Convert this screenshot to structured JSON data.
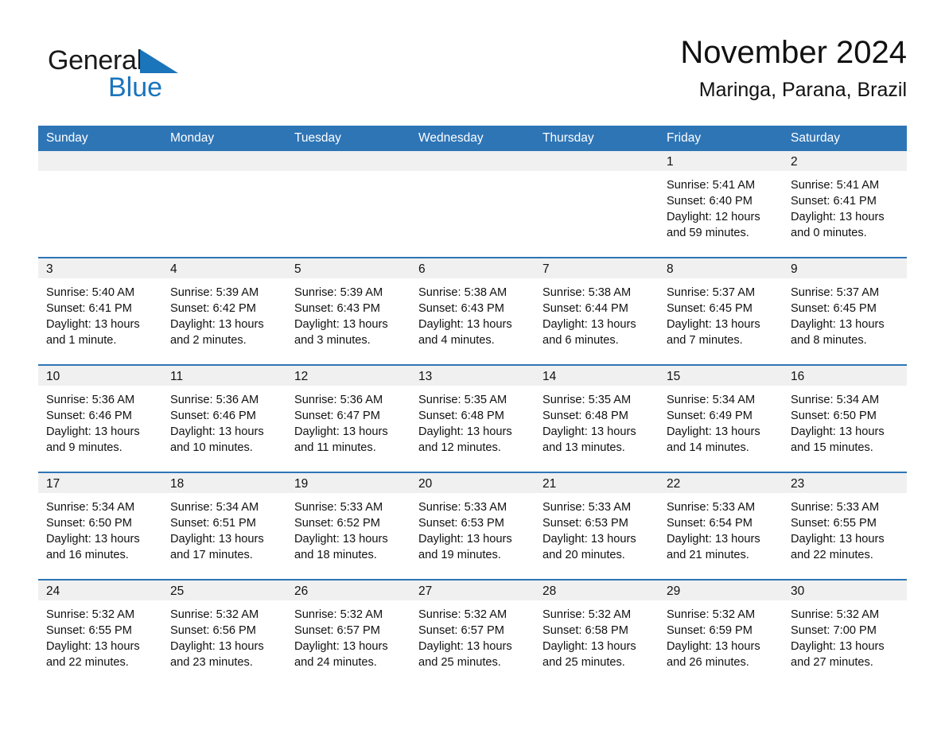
{
  "brand": {
    "word1": "General",
    "word2": "Blue",
    "triangle_color": "#1a75bb",
    "text_color": "#1a1a1a"
  },
  "header": {
    "title": "November 2024",
    "subtitle": "Maringa, Parana, Brazil"
  },
  "theme": {
    "header_blue": "#2e75b6",
    "row_divider_blue": "#2e75b6",
    "daynum_band_gray": "#f0f0f0",
    "page_background": "#ffffff"
  },
  "calendar": {
    "weekday_headers": [
      "Sunday",
      "Monday",
      "Tuesday",
      "Wednesday",
      "Thursday",
      "Friday",
      "Saturday"
    ],
    "weeks": [
      [
        {
          "day": "",
          "empty": true,
          "sunrise": "",
          "sunset": "",
          "daylight1": "",
          "daylight2": ""
        },
        {
          "day": "",
          "empty": true,
          "sunrise": "",
          "sunset": "",
          "daylight1": "",
          "daylight2": ""
        },
        {
          "day": "",
          "empty": true,
          "sunrise": "",
          "sunset": "",
          "daylight1": "",
          "daylight2": ""
        },
        {
          "day": "",
          "empty": true,
          "sunrise": "",
          "sunset": "",
          "daylight1": "",
          "daylight2": ""
        },
        {
          "day": "",
          "empty": true,
          "sunrise": "",
          "sunset": "",
          "daylight1": "",
          "daylight2": ""
        },
        {
          "day": "1",
          "empty": false,
          "sunrise": "Sunrise: 5:41 AM",
          "sunset": "Sunset: 6:40 PM",
          "daylight1": "Daylight: 12 hours",
          "daylight2": "and 59 minutes."
        },
        {
          "day": "2",
          "empty": false,
          "sunrise": "Sunrise: 5:41 AM",
          "sunset": "Sunset: 6:41 PM",
          "daylight1": "Daylight: 13 hours",
          "daylight2": "and 0 minutes."
        }
      ],
      [
        {
          "day": "3",
          "empty": false,
          "sunrise": "Sunrise: 5:40 AM",
          "sunset": "Sunset: 6:41 PM",
          "daylight1": "Daylight: 13 hours",
          "daylight2": "and 1 minute."
        },
        {
          "day": "4",
          "empty": false,
          "sunrise": "Sunrise: 5:39 AM",
          "sunset": "Sunset: 6:42 PM",
          "daylight1": "Daylight: 13 hours",
          "daylight2": "and 2 minutes."
        },
        {
          "day": "5",
          "empty": false,
          "sunrise": "Sunrise: 5:39 AM",
          "sunset": "Sunset: 6:43 PM",
          "daylight1": "Daylight: 13 hours",
          "daylight2": "and 3 minutes."
        },
        {
          "day": "6",
          "empty": false,
          "sunrise": "Sunrise: 5:38 AM",
          "sunset": "Sunset: 6:43 PM",
          "daylight1": "Daylight: 13 hours",
          "daylight2": "and 4 minutes."
        },
        {
          "day": "7",
          "empty": false,
          "sunrise": "Sunrise: 5:38 AM",
          "sunset": "Sunset: 6:44 PM",
          "daylight1": "Daylight: 13 hours",
          "daylight2": "and 6 minutes."
        },
        {
          "day": "8",
          "empty": false,
          "sunrise": "Sunrise: 5:37 AM",
          "sunset": "Sunset: 6:45 PM",
          "daylight1": "Daylight: 13 hours",
          "daylight2": "and 7 minutes."
        },
        {
          "day": "9",
          "empty": false,
          "sunrise": "Sunrise: 5:37 AM",
          "sunset": "Sunset: 6:45 PM",
          "daylight1": "Daylight: 13 hours",
          "daylight2": "and 8 minutes."
        }
      ],
      [
        {
          "day": "10",
          "empty": false,
          "sunrise": "Sunrise: 5:36 AM",
          "sunset": "Sunset: 6:46 PM",
          "daylight1": "Daylight: 13 hours",
          "daylight2": "and 9 minutes."
        },
        {
          "day": "11",
          "empty": false,
          "sunrise": "Sunrise: 5:36 AM",
          "sunset": "Sunset: 6:46 PM",
          "daylight1": "Daylight: 13 hours",
          "daylight2": "and 10 minutes."
        },
        {
          "day": "12",
          "empty": false,
          "sunrise": "Sunrise: 5:36 AM",
          "sunset": "Sunset: 6:47 PM",
          "daylight1": "Daylight: 13 hours",
          "daylight2": "and 11 minutes."
        },
        {
          "day": "13",
          "empty": false,
          "sunrise": "Sunrise: 5:35 AM",
          "sunset": "Sunset: 6:48 PM",
          "daylight1": "Daylight: 13 hours",
          "daylight2": "and 12 minutes."
        },
        {
          "day": "14",
          "empty": false,
          "sunrise": "Sunrise: 5:35 AM",
          "sunset": "Sunset: 6:48 PM",
          "daylight1": "Daylight: 13 hours",
          "daylight2": "and 13 minutes."
        },
        {
          "day": "15",
          "empty": false,
          "sunrise": "Sunrise: 5:34 AM",
          "sunset": "Sunset: 6:49 PM",
          "daylight1": "Daylight: 13 hours",
          "daylight2": "and 14 minutes."
        },
        {
          "day": "16",
          "empty": false,
          "sunrise": "Sunrise: 5:34 AM",
          "sunset": "Sunset: 6:50 PM",
          "daylight1": "Daylight: 13 hours",
          "daylight2": "and 15 minutes."
        }
      ],
      [
        {
          "day": "17",
          "empty": false,
          "sunrise": "Sunrise: 5:34 AM",
          "sunset": "Sunset: 6:50 PM",
          "daylight1": "Daylight: 13 hours",
          "daylight2": "and 16 minutes."
        },
        {
          "day": "18",
          "empty": false,
          "sunrise": "Sunrise: 5:34 AM",
          "sunset": "Sunset: 6:51 PM",
          "daylight1": "Daylight: 13 hours",
          "daylight2": "and 17 minutes."
        },
        {
          "day": "19",
          "empty": false,
          "sunrise": "Sunrise: 5:33 AM",
          "sunset": "Sunset: 6:52 PM",
          "daylight1": "Daylight: 13 hours",
          "daylight2": "and 18 minutes."
        },
        {
          "day": "20",
          "empty": false,
          "sunrise": "Sunrise: 5:33 AM",
          "sunset": "Sunset: 6:53 PM",
          "daylight1": "Daylight: 13 hours",
          "daylight2": "and 19 minutes."
        },
        {
          "day": "21",
          "empty": false,
          "sunrise": "Sunrise: 5:33 AM",
          "sunset": "Sunset: 6:53 PM",
          "daylight1": "Daylight: 13 hours",
          "daylight2": "and 20 minutes."
        },
        {
          "day": "22",
          "empty": false,
          "sunrise": "Sunrise: 5:33 AM",
          "sunset": "Sunset: 6:54 PM",
          "daylight1": "Daylight: 13 hours",
          "daylight2": "and 21 minutes."
        },
        {
          "day": "23",
          "empty": false,
          "sunrise": "Sunrise: 5:33 AM",
          "sunset": "Sunset: 6:55 PM",
          "daylight1": "Daylight: 13 hours",
          "daylight2": "and 22 minutes."
        }
      ],
      [
        {
          "day": "24",
          "empty": false,
          "sunrise": "Sunrise: 5:32 AM",
          "sunset": "Sunset: 6:55 PM",
          "daylight1": "Daylight: 13 hours",
          "daylight2": "and 22 minutes."
        },
        {
          "day": "25",
          "empty": false,
          "sunrise": "Sunrise: 5:32 AM",
          "sunset": "Sunset: 6:56 PM",
          "daylight1": "Daylight: 13 hours",
          "daylight2": "and 23 minutes."
        },
        {
          "day": "26",
          "empty": false,
          "sunrise": "Sunrise: 5:32 AM",
          "sunset": "Sunset: 6:57 PM",
          "daylight1": "Daylight: 13 hours",
          "daylight2": "and 24 minutes."
        },
        {
          "day": "27",
          "empty": false,
          "sunrise": "Sunrise: 5:32 AM",
          "sunset": "Sunset: 6:57 PM",
          "daylight1": "Daylight: 13 hours",
          "daylight2": "and 25 minutes."
        },
        {
          "day": "28",
          "empty": false,
          "sunrise": "Sunrise: 5:32 AM",
          "sunset": "Sunset: 6:58 PM",
          "daylight1": "Daylight: 13 hours",
          "daylight2": "and 25 minutes."
        },
        {
          "day": "29",
          "empty": false,
          "sunrise": "Sunrise: 5:32 AM",
          "sunset": "Sunset: 6:59 PM",
          "daylight1": "Daylight: 13 hours",
          "daylight2": "and 26 minutes."
        },
        {
          "day": "30",
          "empty": false,
          "sunrise": "Sunrise: 5:32 AM",
          "sunset": "Sunset: 7:00 PM",
          "daylight1": "Daylight: 13 hours",
          "daylight2": "and 27 minutes."
        }
      ]
    ]
  }
}
